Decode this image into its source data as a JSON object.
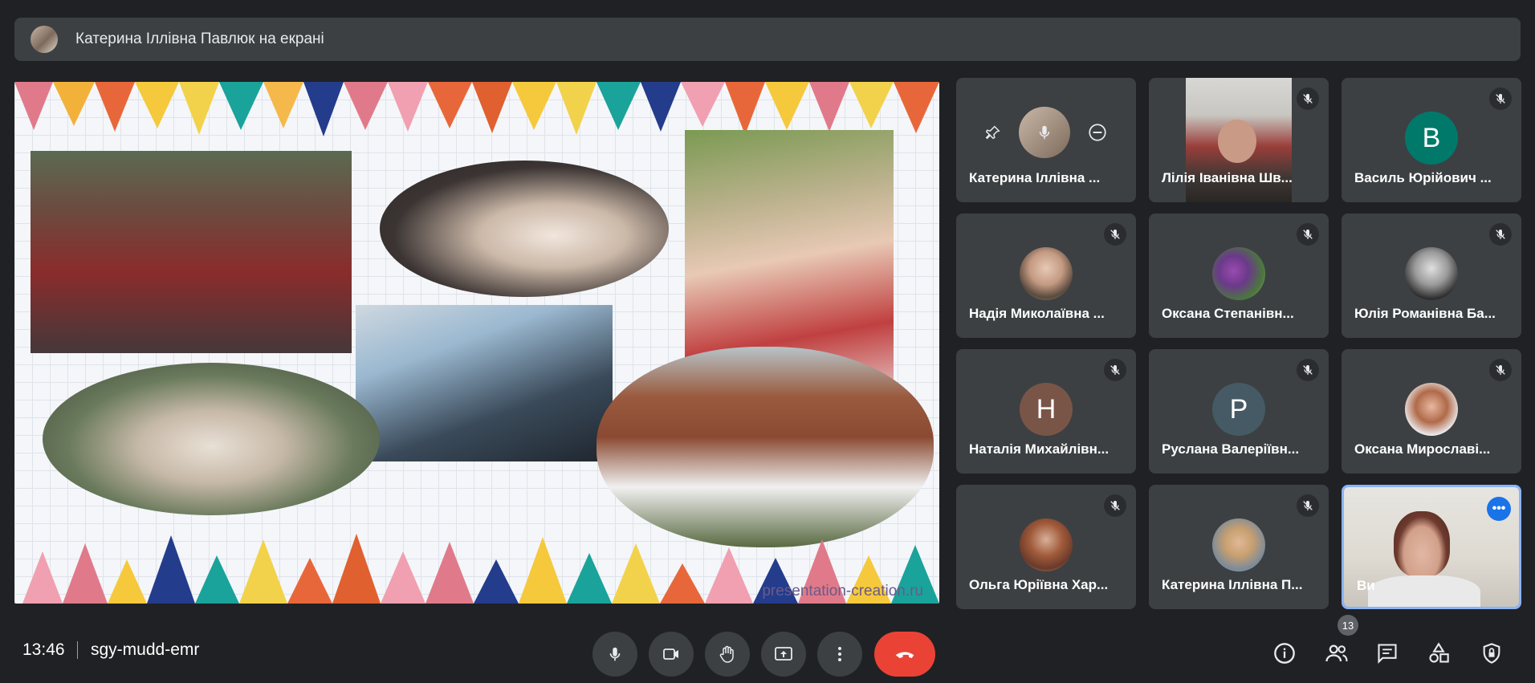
{
  "banner": {
    "text": "Катерина Іллівна Павлюк на екрані"
  },
  "presentation": {
    "watermark": "presentation-creation.ru"
  },
  "participants": [
    {
      "name": "Катерина Іллівна ...",
      "avatar_letter": ""
    },
    {
      "name": "Лілія Іванівна Шв...",
      "avatar_letter": ""
    },
    {
      "name": "Василь Юрійович ...",
      "avatar_letter": "В",
      "avatar_color": "#00796b"
    },
    {
      "name": "Надія Миколаївна ...",
      "avatar_letter": ""
    },
    {
      "name": "Оксана Степанівн...",
      "avatar_letter": ""
    },
    {
      "name": "Юлія Романівна Ба...",
      "avatar_letter": ""
    },
    {
      "name": "Наталія Михайлівн...",
      "avatar_letter": "Н",
      "avatar_color": "#795548"
    },
    {
      "name": "Руслана Валеріївн...",
      "avatar_letter": "Р",
      "avatar_color": "#455a64"
    },
    {
      "name": "Оксана Мирославі...",
      "avatar_letter": ""
    },
    {
      "name": "Ольга Юріївна Хар...",
      "avatar_letter": ""
    },
    {
      "name": "Катерина Іллівна П...",
      "avatar_letter": ""
    },
    {
      "name": "Ви",
      "avatar_letter": ""
    }
  ],
  "bottom": {
    "time": "13:46",
    "meeting_code": "sgy-mudd-emr",
    "participant_count": "13"
  },
  "colors": {
    "accent": "#8ab4f8",
    "hangup": "#ea4335",
    "more_button": "#1a73e8"
  }
}
